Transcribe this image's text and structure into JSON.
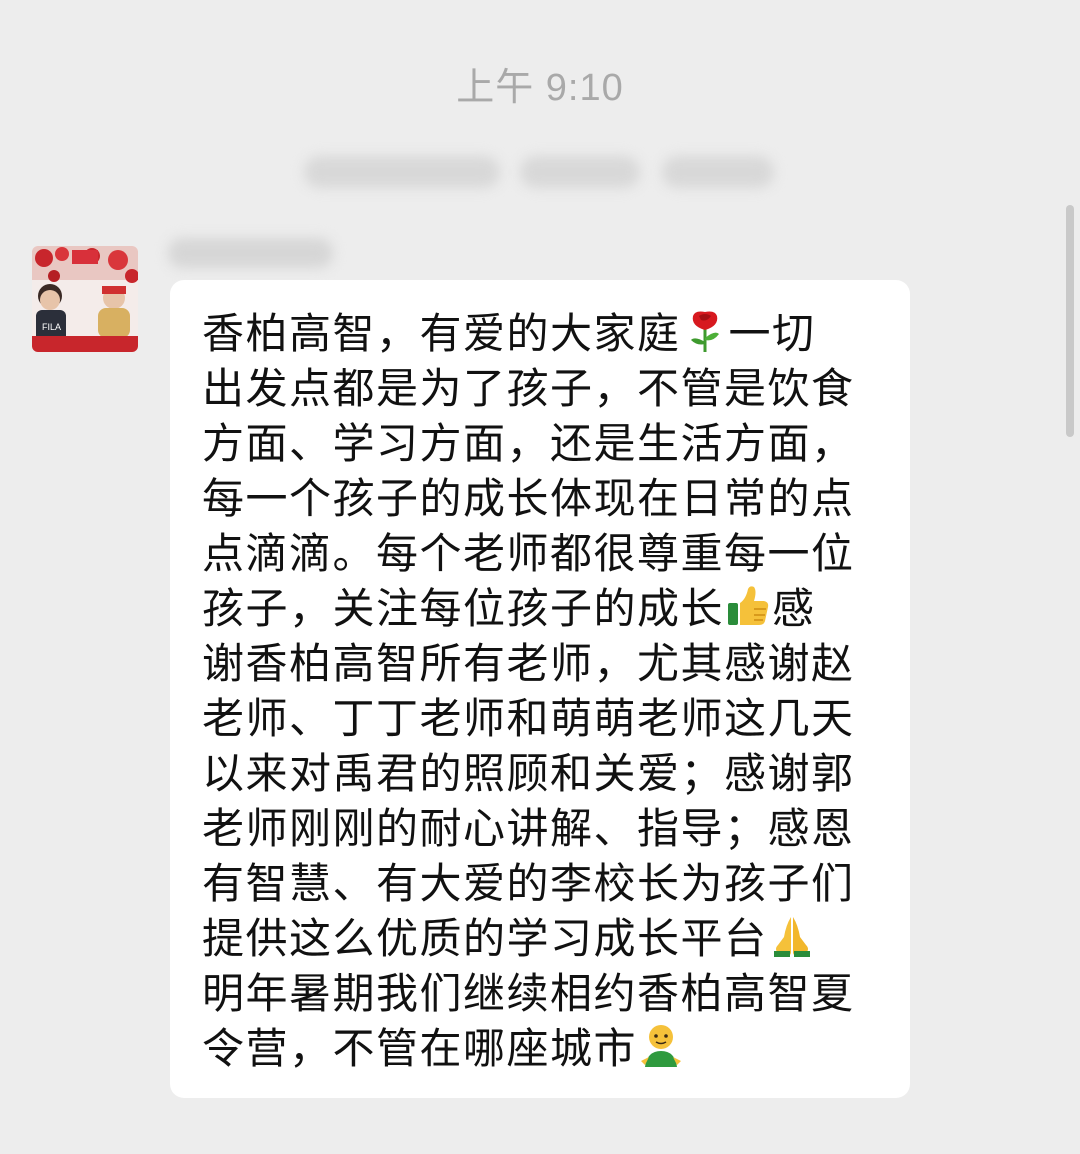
{
  "header": {
    "timestamp": "上午 9:10"
  },
  "message": {
    "lines": [
      {
        "parts": [
          "香柏高智，有爱的大家庭",
          "一切"
        ],
        "emoji": "rose-icon"
      },
      {
        "parts": [
          "出发点都是为了孩子，不管是饮食"
        ]
      },
      {
        "parts": [
          "方面、学习方面，还是生活方面，"
        ]
      },
      {
        "parts": [
          "每一个孩子的成长体现在日常的点"
        ]
      },
      {
        "parts": [
          "点滴滴。每个老师都很尊重每一位"
        ]
      },
      {
        "parts": [
          "孩子，关注每位孩子的成长",
          "感"
        ],
        "emoji": "thumbs-up-icon"
      },
      {
        "parts": [
          "谢香柏高智所有老师，尤其感谢赵"
        ]
      },
      {
        "parts": [
          "老师、丁丁老师和萌萌老师这几天"
        ]
      },
      {
        "parts": [
          "以来对禹君的照顾和关爱；感谢郭"
        ]
      },
      {
        "parts": [
          "老师刚刚的耐心讲解、指导；感恩"
        ]
      },
      {
        "parts": [
          "有智慧、有大爱的李校长为孩子们"
        ]
      },
      {
        "parts": [
          "提供这么优质的学习成长平台",
          ""
        ],
        "emoji": "praying-hands-icon"
      },
      {
        "parts": [
          "明年暑期我们继续相约香柏高智夏"
        ]
      },
      {
        "parts": [
          "令营，不管在哪座城市",
          ""
        ],
        "emoji": "person-icon"
      }
    ]
  },
  "colors": {
    "background": "#ededed",
    "bubble": "#ffffff",
    "timestamp": "#a9a9a9",
    "text": "#111111"
  }
}
